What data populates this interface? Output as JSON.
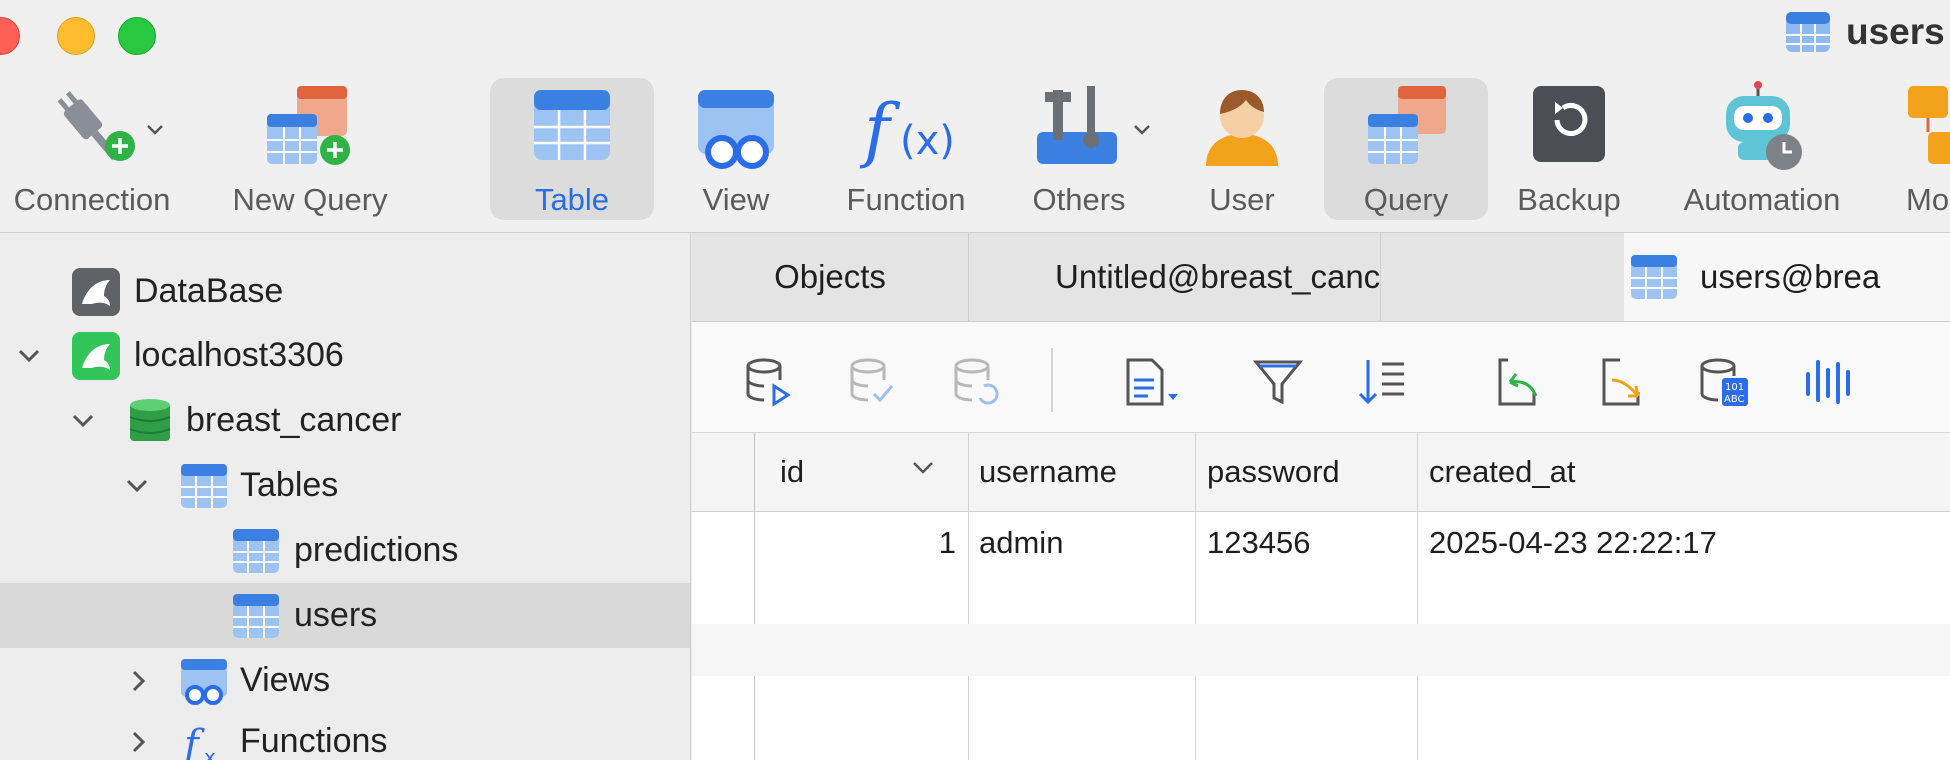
{
  "window": {
    "title": "users"
  },
  "toolbar": {
    "items": [
      {
        "label": "Connection",
        "icon": "plug-add-icon"
      },
      {
        "label": "New Query",
        "icon": "new-query-icon"
      },
      {
        "label": "Table",
        "icon": "table-icon",
        "active": true
      },
      {
        "label": "View",
        "icon": "view-icon"
      },
      {
        "label": "Function",
        "icon": "function-icon"
      },
      {
        "label": "Others",
        "icon": "tools-icon"
      },
      {
        "label": "User",
        "icon": "user-icon"
      },
      {
        "label": "Query",
        "icon": "query-icon",
        "active": true
      },
      {
        "label": "Backup",
        "icon": "backup-icon"
      },
      {
        "label": "Automation",
        "icon": "robot-icon"
      },
      {
        "label": "Mo",
        "icon": "model-icon"
      }
    ]
  },
  "sidebar": {
    "items": [
      {
        "label": "DataBase"
      },
      {
        "label": "localhost3306"
      },
      {
        "label": "breast_cancer"
      },
      {
        "label": "Tables"
      },
      {
        "label": "predictions"
      },
      {
        "label": "users",
        "selected": true
      },
      {
        "label": "Views"
      },
      {
        "label": "Functions"
      }
    ]
  },
  "tabs": [
    {
      "label": "Objects"
    },
    {
      "label": "Untitled@breast_cancer..."
    },
    {
      "label": "users@brea",
      "active": true
    }
  ],
  "grid": {
    "columns": [
      "id",
      "username",
      "password",
      "created_at"
    ],
    "rows": [
      {
        "id": "1",
        "username": "admin",
        "password": "123456",
        "created_at": "2025-04-23 22:22:17"
      }
    ]
  },
  "colors": {
    "accent": "#2b6de8",
    "selected_row": "#d9d9d9"
  }
}
